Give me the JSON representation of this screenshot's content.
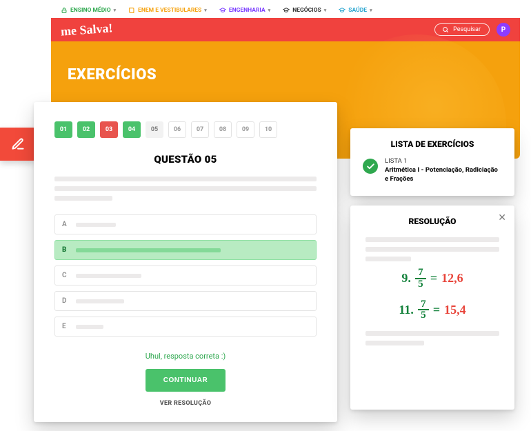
{
  "colors": {
    "primary_red": "#f0423e",
    "accent_orange": "#f5a10d",
    "success": "#4ac26b",
    "success_dark": "#2fa84f",
    "error": "#e8544e",
    "purple": "#8d3cff"
  },
  "topnav": {
    "items": [
      {
        "label": "ENSINO MÉDIO",
        "color": "#2fa84f",
        "icon": "lock-icon"
      },
      {
        "label": "ENEM E VESTIBULARES",
        "color": "#f5a10d",
        "icon": "book-icon"
      },
      {
        "label": "ENGENHARIA",
        "color": "#7a3cff",
        "icon": "grad-cap-icon"
      },
      {
        "label": "NEGÓCIOS",
        "color": "#333333",
        "icon": "grad-cap-icon"
      },
      {
        "label": "SAÚDE",
        "color": "#2aa6d0",
        "icon": "grad-cap-icon"
      }
    ]
  },
  "header": {
    "logo": "me Salva!",
    "search_placeholder": "Pesquisar",
    "avatar_initial": "P"
  },
  "hero": {
    "title": "EXERCÍCIOS"
  },
  "exercise": {
    "questions": [
      {
        "n": "01",
        "status": "correct"
      },
      {
        "n": "02",
        "status": "correct"
      },
      {
        "n": "03",
        "status": "wrong"
      },
      {
        "n": "04",
        "status": "correct"
      },
      {
        "n": "05",
        "status": "current"
      },
      {
        "n": "06",
        "status": "future"
      },
      {
        "n": "07",
        "status": "future"
      },
      {
        "n": "08",
        "status": "future"
      },
      {
        "n": "09",
        "status": "future"
      },
      {
        "n": "10",
        "status": "future"
      }
    ],
    "title": "QUESTÃO 05",
    "answers": [
      {
        "letter": "A",
        "selected": false
      },
      {
        "letter": "B",
        "selected": true
      },
      {
        "letter": "C",
        "selected": false
      },
      {
        "letter": "D",
        "selected": false
      },
      {
        "letter": "E",
        "selected": false
      }
    ],
    "feedback": "Uhul, resposta correta :)",
    "continue_label": "CONTINUAR",
    "see_resolution_label": "VER RESOLUÇÃO"
  },
  "list_panel": {
    "heading": "LISTA DE EXERCÍCIOS",
    "list_label": "LISTA 1",
    "list_name": "Aritmética I - Potenciação, Radiciação e Frações"
  },
  "resolution_panel": {
    "heading": "RESOLUÇÃO",
    "lines": [
      {
        "index": "9",
        "frac_top": "7",
        "frac_bot": "5",
        "result": "12,6"
      },
      {
        "index": "11",
        "frac_top": "7",
        "frac_bot": "5",
        "result": "15,4"
      }
    ]
  }
}
